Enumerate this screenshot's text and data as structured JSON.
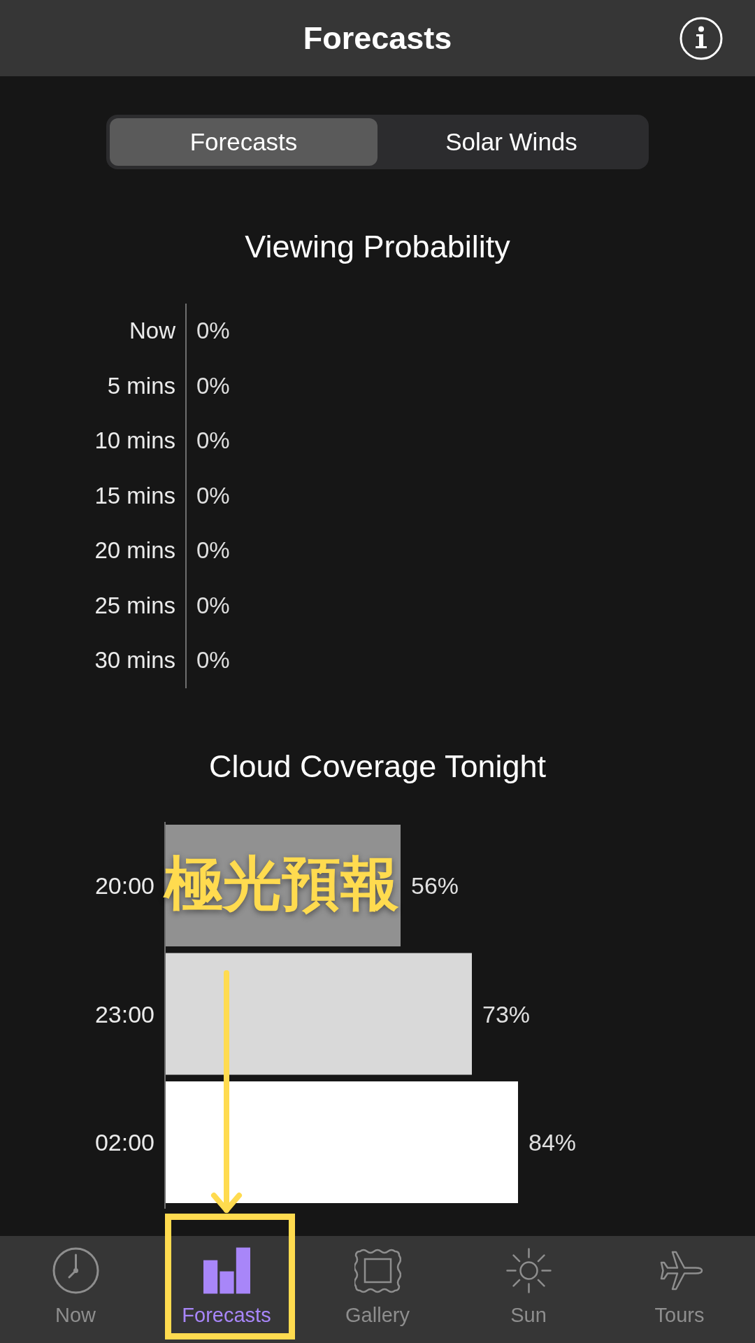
{
  "header": {
    "title": "Forecasts"
  },
  "segments": [
    {
      "label": "Forecasts",
      "selected": true
    },
    {
      "label": "Solar Winds",
      "selected": false
    }
  ],
  "viewing_probability": {
    "title": "Viewing Probability",
    "rows": [
      {
        "label": "Now",
        "value": "0%"
      },
      {
        "label": "5 mins",
        "value": "0%"
      },
      {
        "label": "10 mins",
        "value": "0%"
      },
      {
        "label": "15 mins",
        "value": "0%"
      },
      {
        "label": "20 mins",
        "value": "0%"
      },
      {
        "label": "25 mins",
        "value": "0%"
      },
      {
        "label": "30 mins",
        "value": "0%"
      }
    ]
  },
  "cloud_coverage": {
    "chart_data": {
      "type": "bar",
      "orientation": "horizontal",
      "title": "Cloud Coverage Tonight",
      "categories": [
        "20:00",
        "23:00",
        "02:00"
      ],
      "series": [
        {
          "color": "#919191",
          "values": [
            56,
            null,
            null
          ],
          "value_labels": [
            "56%",
            null,
            null
          ]
        },
        {
          "color": "#d9d9d9",
          "values": [
            null,
            73,
            null
          ],
          "value_labels": [
            null,
            "73%",
            null
          ]
        },
        {
          "color": "#ffffff",
          "values": [
            null,
            null,
            84
          ],
          "value_labels": [
            null,
            null,
            "84%"
          ]
        }
      ],
      "stacked": true
    }
  },
  "annotation": {
    "text": "極光預報"
  },
  "tabs": [
    {
      "label": "Now",
      "selected": false
    },
    {
      "label": "Forecasts",
      "selected": true
    },
    {
      "label": "Gallery",
      "selected": false
    },
    {
      "label": "Sun",
      "selected": false
    },
    {
      "label": "Tours",
      "selected": false
    }
  ]
}
